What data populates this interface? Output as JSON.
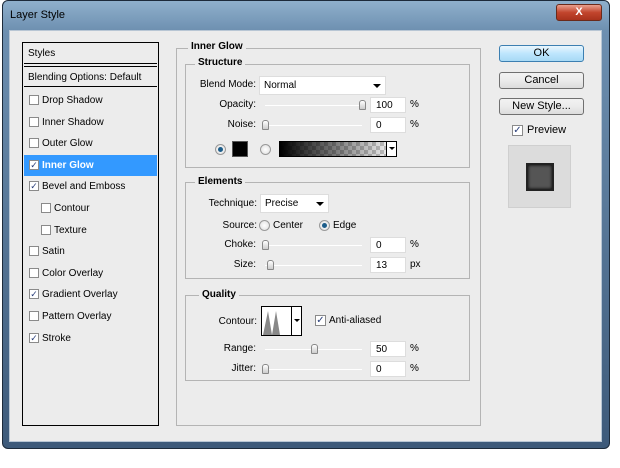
{
  "window": {
    "title": "Layer Style",
    "close_label": "X"
  },
  "sidebar": {
    "header": "Styles",
    "blending": "Blending Options: Default",
    "items": [
      {
        "label": "Drop Shadow",
        "checked": false,
        "indent": false
      },
      {
        "label": "Inner Shadow",
        "checked": false,
        "indent": false
      },
      {
        "label": "Outer Glow",
        "checked": false,
        "indent": false
      },
      {
        "label": "Inner Glow",
        "checked": true,
        "indent": false,
        "selected": true
      },
      {
        "label": "Bevel and Emboss",
        "checked": true,
        "indent": false
      },
      {
        "label": "Contour",
        "checked": false,
        "indent": true
      },
      {
        "label": "Texture",
        "checked": false,
        "indent": true
      },
      {
        "label": "Satin",
        "checked": false,
        "indent": false
      },
      {
        "label": "Color Overlay",
        "checked": false,
        "indent": false
      },
      {
        "label": "Gradient Overlay",
        "checked": true,
        "indent": false
      },
      {
        "label": "Pattern Overlay",
        "checked": false,
        "indent": false
      },
      {
        "label": "Stroke",
        "checked": true,
        "indent": false
      }
    ]
  },
  "panel": {
    "title": "Inner Glow",
    "structure": {
      "title": "Structure",
      "blend_mode_label": "Blend Mode:",
      "blend_mode": "Normal",
      "opacity_label": "Opacity:",
      "opacity": "100",
      "noise_label": "Noise:",
      "noise": "0",
      "unit": "%",
      "color": "#000000",
      "color_mode": "solid"
    },
    "elements": {
      "title": "Elements",
      "technique_label": "Technique:",
      "technique": "Precise",
      "source_label": "Source:",
      "source_center": "Center",
      "source_edge": "Edge",
      "source_selected": "Edge",
      "choke_label": "Choke:",
      "choke": "0",
      "choke_unit": "%",
      "size_label": "Size:",
      "size": "13",
      "size_unit": "px"
    },
    "quality": {
      "title": "Quality",
      "contour_label": "Contour:",
      "anti_aliased_label": "Anti-aliased",
      "anti_aliased": true,
      "range_label": "Range:",
      "range": "50",
      "range_unit": "%",
      "jitter_label": "Jitter:",
      "jitter": "0",
      "jitter_unit": "%"
    }
  },
  "buttons": {
    "ok": "OK",
    "cancel": "Cancel",
    "new_style": "New Style...",
    "preview_label": "Preview",
    "preview": true
  },
  "sliders": {
    "opacity": 1.0,
    "noise": 0,
    "choke": 0,
    "size": 0.052,
    "range": 0.5,
    "jitter": 0
  }
}
